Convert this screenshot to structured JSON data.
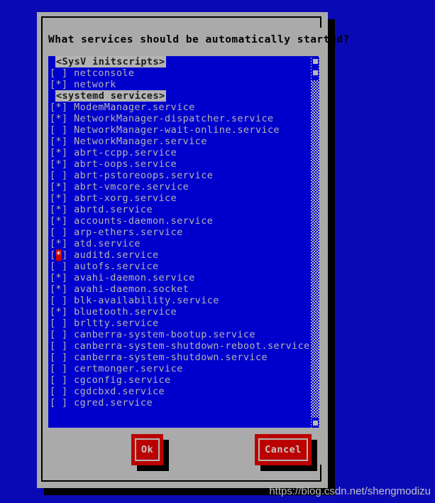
{
  "dialog": {
    "title": "What services should be automatically started?"
  },
  "colors": {
    "desktop_background": "#0a0ab4",
    "dialog_background": "#aaaaaa",
    "listbox_background": "#0000cc",
    "list_text": "#b4b4b4",
    "header_background": "#b4b4b4",
    "button_background": "#bb0000",
    "cursor_highlight": "#cc0000",
    "shadow": "#000000"
  },
  "list": {
    "rows": [
      {
        "type": "header",
        "label": "<SysV initscripts>"
      },
      {
        "type": "item",
        "checked": false,
        "cursor": false,
        "label": "netconsole"
      },
      {
        "type": "item",
        "checked": true,
        "cursor": false,
        "label": "network"
      },
      {
        "type": "header",
        "label": "<systemd services>"
      },
      {
        "type": "item",
        "checked": true,
        "cursor": false,
        "label": "ModemManager.service"
      },
      {
        "type": "item",
        "checked": true,
        "cursor": false,
        "label": "NetworkManager-dispatcher.service"
      },
      {
        "type": "item",
        "checked": false,
        "cursor": false,
        "label": "NetworkManager-wait-online.service"
      },
      {
        "type": "item",
        "checked": true,
        "cursor": false,
        "label": "NetworkManager.service"
      },
      {
        "type": "item",
        "checked": true,
        "cursor": false,
        "label": "abrt-ccpp.service"
      },
      {
        "type": "item",
        "checked": true,
        "cursor": false,
        "label": "abrt-oops.service"
      },
      {
        "type": "item",
        "checked": false,
        "cursor": false,
        "label": "abrt-pstoreoops.service"
      },
      {
        "type": "item",
        "checked": true,
        "cursor": false,
        "label": "abrt-vmcore.service"
      },
      {
        "type": "item",
        "checked": true,
        "cursor": false,
        "label": "abrt-xorg.service"
      },
      {
        "type": "item",
        "checked": true,
        "cursor": false,
        "label": "abrtd.service"
      },
      {
        "type": "item",
        "checked": true,
        "cursor": false,
        "label": "accounts-daemon.service"
      },
      {
        "type": "item",
        "checked": false,
        "cursor": false,
        "label": "arp-ethers.service"
      },
      {
        "type": "item",
        "checked": true,
        "cursor": false,
        "label": "atd.service"
      },
      {
        "type": "item",
        "checked": true,
        "cursor": true,
        "label": "auditd.service"
      },
      {
        "type": "item",
        "checked": false,
        "cursor": false,
        "label": "autofs.service"
      },
      {
        "type": "item",
        "checked": true,
        "cursor": false,
        "label": "avahi-daemon.service"
      },
      {
        "type": "item",
        "checked": true,
        "cursor": false,
        "label": "avahi-daemon.socket"
      },
      {
        "type": "item",
        "checked": false,
        "cursor": false,
        "label": "blk-availability.service"
      },
      {
        "type": "item",
        "checked": true,
        "cursor": false,
        "label": "bluetooth.service"
      },
      {
        "type": "item",
        "checked": false,
        "cursor": false,
        "label": "brltty.service"
      },
      {
        "type": "item",
        "checked": false,
        "cursor": false,
        "label": "canberra-system-bootup.service"
      },
      {
        "type": "item",
        "checked": false,
        "cursor": false,
        "label": "canberra-system-shutdown-reboot.service"
      },
      {
        "type": "item",
        "checked": false,
        "cursor": false,
        "label": "canberra-system-shutdown.service"
      },
      {
        "type": "item",
        "checked": false,
        "cursor": false,
        "label": "certmonger.service"
      },
      {
        "type": "item",
        "checked": false,
        "cursor": false,
        "label": "cgconfig.service"
      },
      {
        "type": "item",
        "checked": false,
        "cursor": false,
        "label": "cgdcbxd.service"
      },
      {
        "type": "item",
        "checked": false,
        "cursor": false,
        "label": "cgred.service"
      }
    ],
    "checked_mark": "[*] ",
    "unchecked_mark": "[ ] "
  },
  "buttons": {
    "ok": "Ok",
    "cancel": "Cancel"
  },
  "watermark": "https://blog.csdn.net/shengmodizu"
}
